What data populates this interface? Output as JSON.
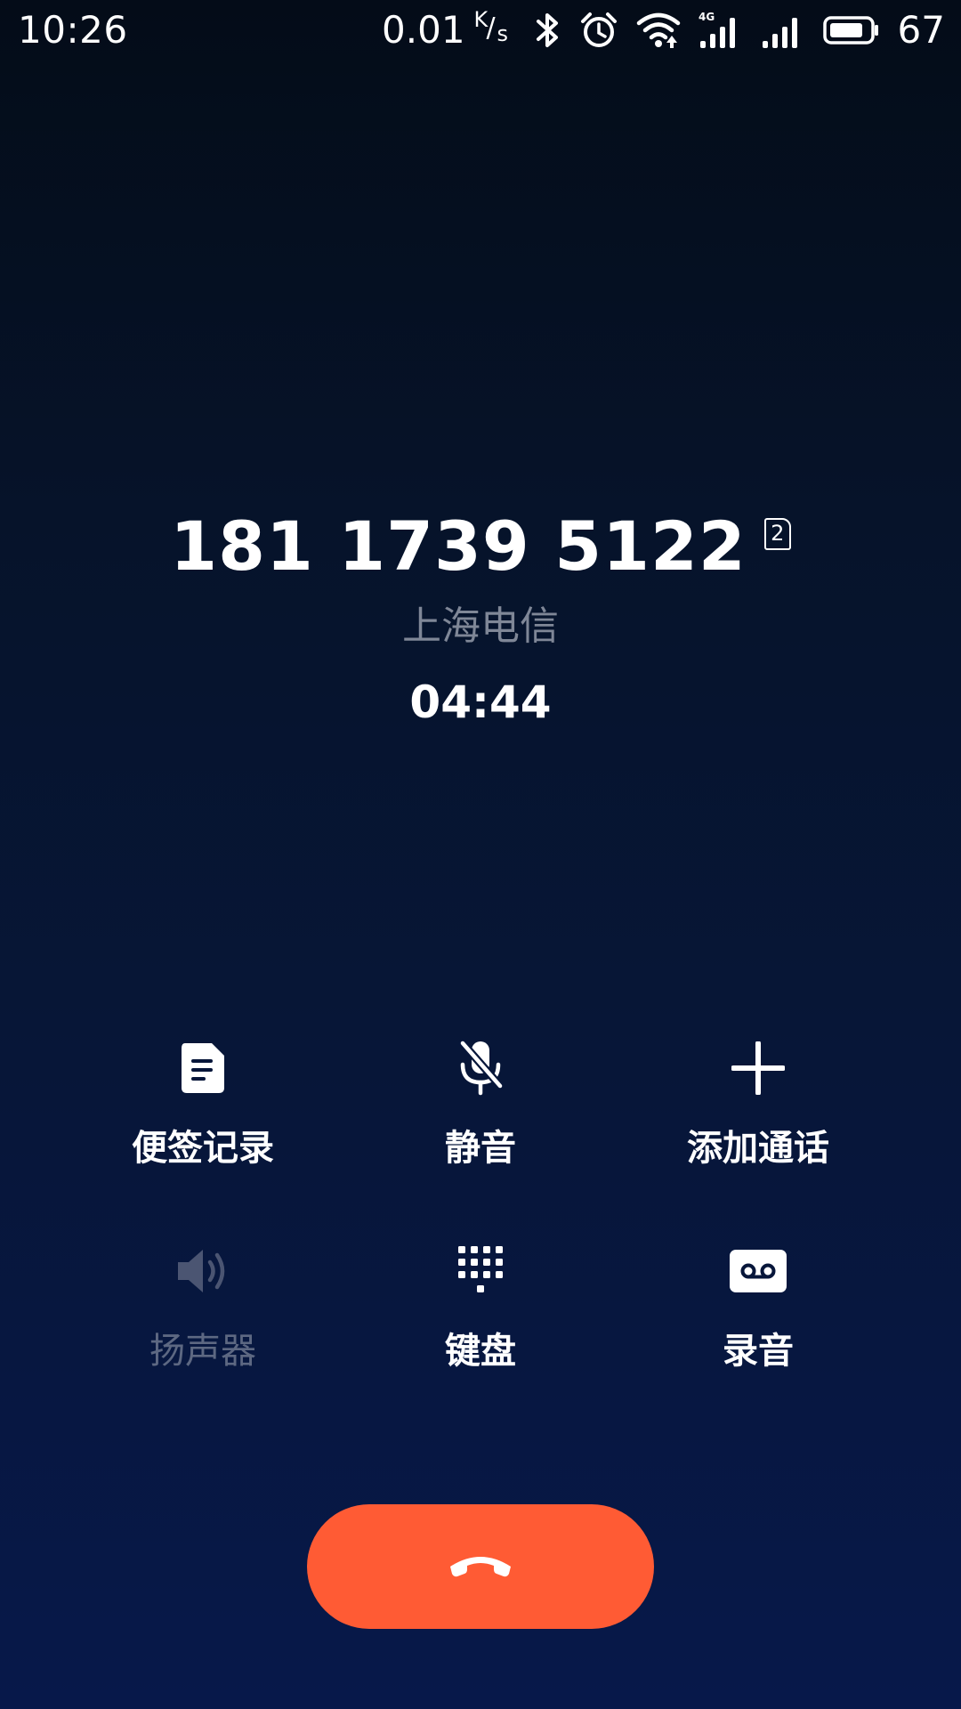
{
  "status_bar": {
    "time": "10:26",
    "net_speed": "0.01",
    "net_unit_top": "K",
    "net_unit_slash": "/",
    "net_unit_bottom": "s",
    "network_type": "4G",
    "battery_percent": "67",
    "icons": [
      "bluetooth-icon",
      "alarm-icon",
      "wifi-icon",
      "signal-4g-icon",
      "signal-icon",
      "battery-icon"
    ]
  },
  "call": {
    "number": "181 1739 5122",
    "sim_slot": "2",
    "location": "上海电信",
    "duration": "04:44"
  },
  "actions": [
    {
      "id": "notes",
      "label": "便签记录",
      "icon": "note-icon",
      "enabled": true
    },
    {
      "id": "mute",
      "label": "静音",
      "icon": "mic-off-icon",
      "enabled": true
    },
    {
      "id": "add-call",
      "label": "添加通话",
      "icon": "plus-icon",
      "enabled": true
    },
    {
      "id": "speaker",
      "label": "扬声器",
      "icon": "speaker-icon",
      "enabled": false
    },
    {
      "id": "keypad",
      "label": "键盘",
      "icon": "dialpad-icon",
      "enabled": true
    },
    {
      "id": "record",
      "label": "录音",
      "icon": "record-tape-icon",
      "enabled": true
    }
  ],
  "hangup": {
    "icon": "end-call-icon",
    "color": "#ff5b34"
  },
  "colors": {
    "background_top": "#040c18",
    "background_bottom": "#07184a",
    "secondary_text": "#7f8797",
    "disabled": "#5d6882"
  }
}
